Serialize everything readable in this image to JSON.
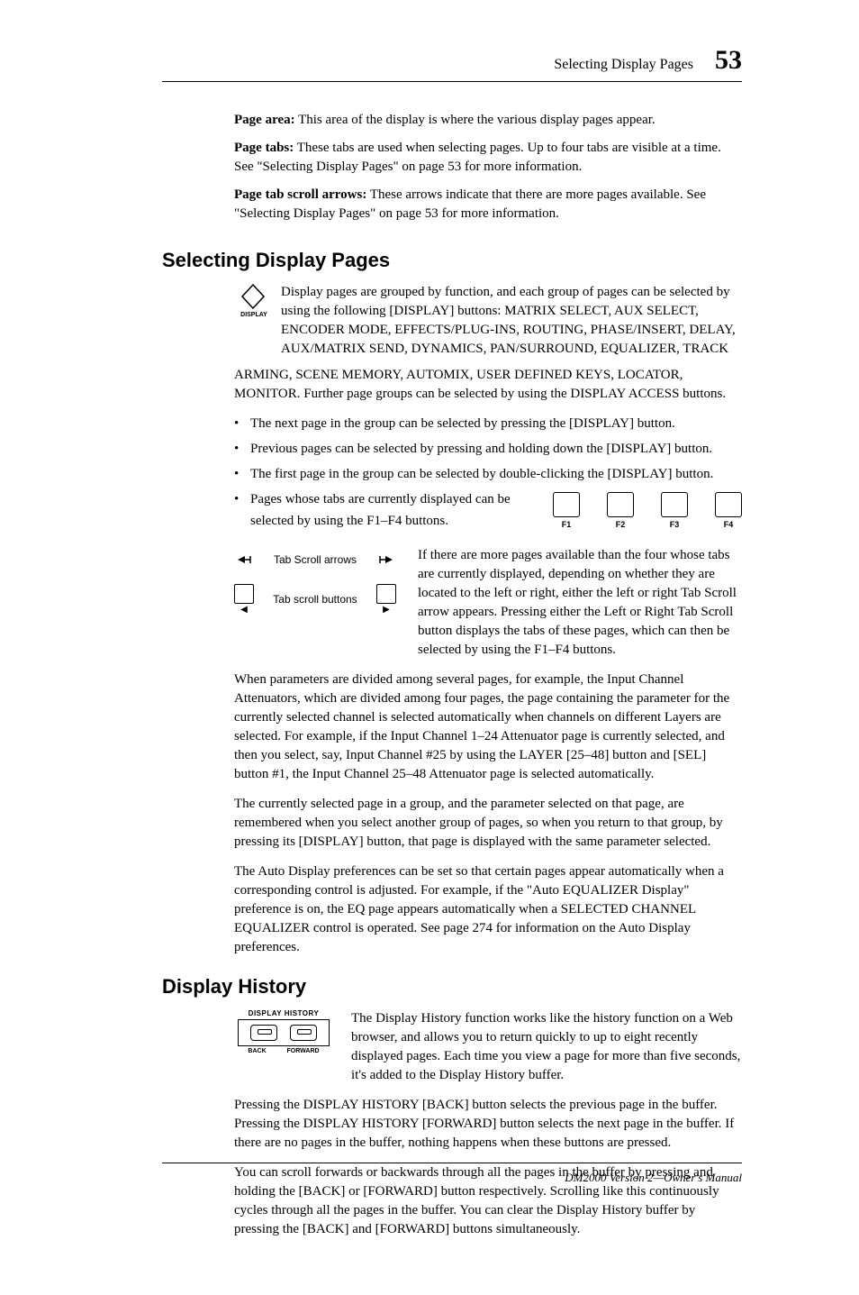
{
  "header": {
    "title": "Selecting Display Pages",
    "page": "53"
  },
  "defs": {
    "page_area_label": "Page area:",
    "page_area_text": " This area of the display is where the various display pages appear.",
    "page_tabs_label": "Page tabs:",
    "page_tabs_text": " These tabs are used when selecting pages. Up to four tabs are visible at a time. See \"Selecting Display Pages\" on page 53 for more information.",
    "page_tab_scroll_label": "Page tab scroll arrows:",
    "page_tab_scroll_text": " These arrows indicate that there are more pages available. See \"Selecting Display Pages\" on page 53 for more information."
  },
  "sec1": {
    "heading": "Selecting Display Pages",
    "display_label": "DISPLAY",
    "intro": "Display pages are grouped by function, and each group of pages can be selected by using the following [DISPLAY] buttons: MATRIX SELECT, AUX SELECT, ENCODER MODE, EFFECTS/PLUG-INS, ROUTING, PHASE/INSERT, DELAY, AUX/MATRIX SEND, DYNAMICS, PAN/SURROUND, EQUALIZER, TRACK",
    "intro_cont": "ARMING, SCENE MEMORY, AUTOMIX, USER DEFINED KEYS, LOCATOR, MONITOR. Further page groups can be selected by using the DISPLAY ACCESS buttons.",
    "bullets": [
      "The next page in the group can be selected by pressing the [DISPLAY] button.",
      "Previous pages can be selected by pressing and holding down the [DISPLAY] button.",
      "The first page in the group can be selected by double-clicking the [DISPLAY] button."
    ],
    "bullet_f": "Pages whose tabs are currently displayed can be selected by using the F1–F4 buttons.",
    "f_labels": [
      "F1",
      "F2",
      "F3",
      "F4"
    ],
    "diag": {
      "arrows_label": "Tab Scroll arrows",
      "buttons_label": "Tab scroll buttons"
    },
    "scroll_text": "If there are more pages available than the four whose tabs are currently displayed, depending on whether they are located to the left or right, either the left or right Tab Scroll arrow appears. Pressing either the Left or Right Tab Scroll button displays the tabs of these pages, which can then be selected by using the F1–F4 buttons.",
    "para1": "When parameters are divided among several pages, for example, the Input Channel Attenuators, which are divided among four pages, the page containing the parameter for the currently selected channel is selected automatically when channels on different Layers are selected. For example, if the Input Channel 1–24 Attenuator page is currently selected, and then you select, say, Input Channel #25 by using the LAYER [25–48] button and [SEL] button #1, the Input Channel 25–48 Attenuator page is selected automatically.",
    "para2": "The currently selected page in a group, and the parameter selected on that page, are remembered when you select another group of pages, so when you return to that group, by pressing its [DISPLAY] button, that page is displayed with the same parameter selected.",
    "para3": "The Auto Display preferences can be set so that certain pages appear automatically when a corresponding control is adjusted. For example, if the \"Auto EQUALIZER Display\" preference is on, the EQ page appears automatically when a SELECTED CHANNEL EQUALIZER control is operated. See page 274 for information on the Auto Display preferences."
  },
  "sec2": {
    "heading": "Display History",
    "dh_title": "DISPLAY  HISTORY",
    "dh_back": "BACK",
    "dh_forward": "FORWARD",
    "text1": "The Display History function works like the history function on a Web browser, and allows you to return quickly to up to eight recently displayed pages. Each time you view a page for more than five seconds, it's added to the Display History buffer.",
    "para1": "Pressing the DISPLAY HISTORY [BACK] button selects the previous page in the buffer. Pressing the DISPLAY HISTORY [FORWARD] button selects the next page in the buffer. If there are no pages in the buffer, nothing happens when these buttons are pressed.",
    "para2": "You can scroll forwards or backwards through all the pages in the buffer by pressing and holding the [BACK] or [FORWARD] button respectively. Scrolling like this continuously cycles through all the pages in the buffer. You can clear the Display History buffer by pressing the [BACK] and [FORWARD] buttons simultaneously."
  },
  "footer": "DM2000 Version 2—Owner's Manual"
}
